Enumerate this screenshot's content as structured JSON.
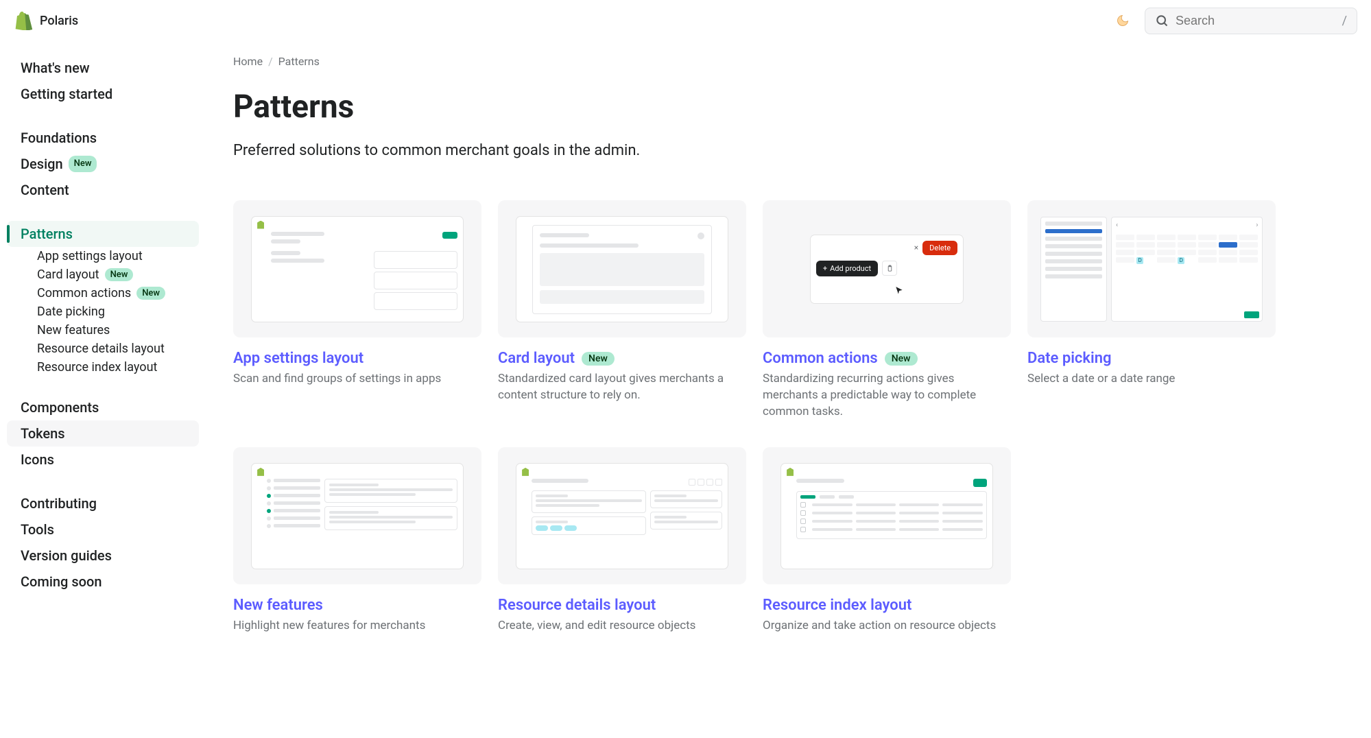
{
  "brand": "Polaris",
  "search": {
    "placeholder": "Search",
    "shortcut": "/"
  },
  "sidebar": {
    "group1": [
      {
        "label": "What's new"
      },
      {
        "label": "Getting started"
      }
    ],
    "group2": [
      {
        "label": "Foundations"
      },
      {
        "label": "Design",
        "badge": "New"
      },
      {
        "label": "Content"
      }
    ],
    "patterns": {
      "label": "Patterns",
      "children": [
        {
          "label": "App settings layout"
        },
        {
          "label": "Card layout",
          "badge": "New"
        },
        {
          "label": "Common actions",
          "badge": "New"
        },
        {
          "label": "Date picking"
        },
        {
          "label": "New features"
        },
        {
          "label": "Resource details layout"
        },
        {
          "label": "Resource index layout"
        }
      ]
    },
    "group4": [
      {
        "label": "Components"
      },
      {
        "label": "Tokens"
      },
      {
        "label": "Icons"
      }
    ],
    "group5": [
      {
        "label": "Contributing"
      },
      {
        "label": "Tools"
      },
      {
        "label": "Version guides"
      },
      {
        "label": "Coming soon"
      }
    ]
  },
  "breadcrumb": {
    "home": "Home",
    "current": "Patterns"
  },
  "page": {
    "title": "Patterns",
    "description": "Preferred solutions to common merchant goals in the admin."
  },
  "actions_thumb": {
    "delete": "Delete",
    "add": "Add product",
    "close": "×",
    "plus": "+"
  },
  "cards": [
    {
      "title": "App settings layout",
      "desc": "Scan and find groups of settings in apps"
    },
    {
      "title": "Card layout",
      "badge": "New",
      "desc": "Standardized card layout gives merchants a content structure to rely on."
    },
    {
      "title": "Common actions",
      "badge": "New",
      "desc": "Standardizing recurring actions gives merchants a predictable way to complete common tasks."
    },
    {
      "title": "Date picking",
      "desc": "Select a date or a date range"
    },
    {
      "title": "New features",
      "desc": "Highlight new features for merchants"
    },
    {
      "title": "Resource details layout",
      "desc": "Create, view, and edit resource objects"
    },
    {
      "title": "Resource index layout",
      "desc": "Organize and take action on resource objects"
    }
  ]
}
